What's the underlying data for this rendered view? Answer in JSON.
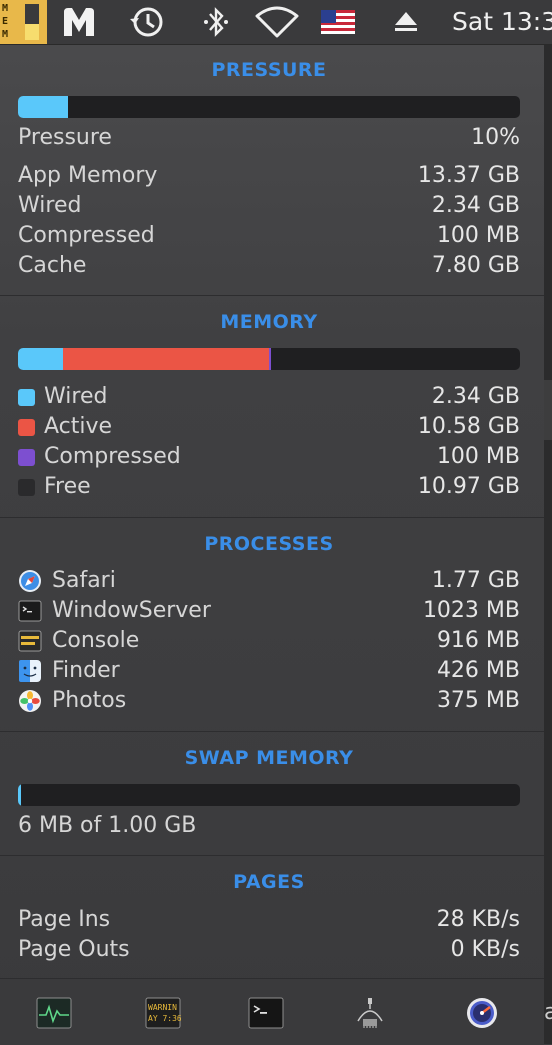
{
  "menubar": {
    "mem_icon_letters": "M\nE\nM",
    "memory_gauge_fraction": 0.45,
    "icons": [
      "memory-meter-icon",
      "malwarebytes-icon",
      "time-machine-icon",
      "bluetooth-icon",
      "wifi-icon",
      "us-flag-icon",
      "eject-icon"
    ],
    "clock": "Sat 13:3"
  },
  "pressure": {
    "title": "PRESSURE",
    "bar_fraction": 0.1,
    "bar_color": "#5ac8fa",
    "rows": [
      {
        "label": "Pressure",
        "value": "10%"
      },
      {
        "label": "App Memory",
        "value": "13.37 GB"
      },
      {
        "label": "Wired",
        "value": "2.34 GB"
      },
      {
        "label": "Compressed",
        "value": "100 MB"
      },
      {
        "label": "Cache",
        "value": "7.80 GB"
      }
    ]
  },
  "memory": {
    "title": "MEMORY",
    "segments": [
      {
        "name": "Wired",
        "fraction": 0.0905,
        "color": "#5ac8fa"
      },
      {
        "name": "Active",
        "fraction": 0.4094,
        "color": "#eb5545"
      },
      {
        "name": "Compressed",
        "fraction": 0.0038,
        "color": "#7d4fd0"
      },
      {
        "name": "Free",
        "fraction": 0.4244,
        "color": "#1f1f21"
      }
    ],
    "rows": [
      {
        "label": "Wired",
        "value": "2.34 GB",
        "color": "#5ac8fa"
      },
      {
        "label": "Active",
        "value": "10.58 GB",
        "color": "#eb5545"
      },
      {
        "label": "Compressed",
        "value": "100 MB",
        "color": "#7d4fd0"
      },
      {
        "label": "Free",
        "value": "10.97 GB",
        "color": "#2a2a2c"
      }
    ]
  },
  "processes": {
    "title": "PROCESSES",
    "rows": [
      {
        "label": "Safari",
        "value": "1.77 GB",
        "icon": "safari-icon"
      },
      {
        "label": "WindowServer",
        "value": "1023 MB",
        "icon": "terminal-icon"
      },
      {
        "label": "Console",
        "value": "916 MB",
        "icon": "console-icon"
      },
      {
        "label": "Finder",
        "value": "426 MB",
        "icon": "finder-icon"
      },
      {
        "label": "Photos",
        "value": "375 MB",
        "icon": "photos-icon"
      }
    ]
  },
  "swap": {
    "title": "SWAP MEMORY",
    "bar_fraction": 0.006,
    "bar_color": "#5ac8fa",
    "text": "6 MB of 1.00 GB"
  },
  "pages": {
    "title": "PAGES",
    "rows": [
      {
        "label": "Page Ins",
        "value": "28 KB/s"
      },
      {
        "label": "Page Outs",
        "value": "0 KB/s"
      }
    ]
  },
  "bottombar": {
    "buttons": [
      "activity-monitor-icon",
      "console-icon",
      "terminal-icon",
      "system-information-icon",
      "istat-menus-icon"
    ],
    "console_icon_text": "WARNIN\nAY 7:36"
  },
  "right_edge_letter": "a"
}
